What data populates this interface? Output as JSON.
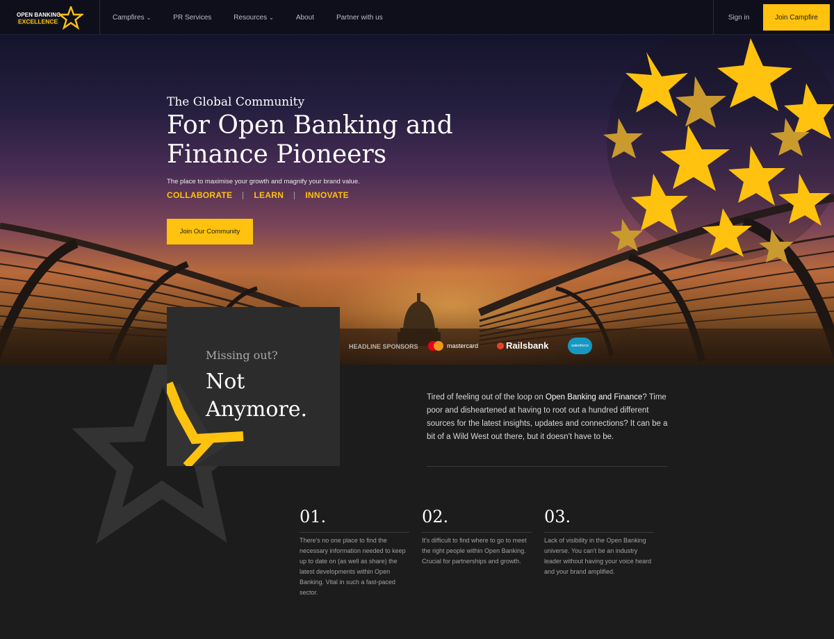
{
  "nav": {
    "logo": {
      "line1": "OPEN BANKING",
      "line2": "EXCELLENCE"
    },
    "items": [
      {
        "label": "Campfires",
        "has_dropdown": true
      },
      {
        "label": "PR Services",
        "has_dropdown": false
      },
      {
        "label": "Resources",
        "has_dropdown": true
      },
      {
        "label": "About",
        "has_dropdown": false
      },
      {
        "label": "Partner with us",
        "has_dropdown": false
      }
    ],
    "sign_in": "Sign in",
    "cta": "Join Campfire"
  },
  "hero": {
    "subtitle": "The Global Community",
    "title": "For Open Banking and Finance Pioneers",
    "description": "The place to maximise your growth and magnify your brand value.",
    "pillars": [
      "COLLABORATE",
      "LEARN",
      "INNOVATE"
    ],
    "cta": "Join Our Community"
  },
  "sponsors": {
    "label": "HEADLINE SPONSORS",
    "logos": [
      "mastercard",
      "Railsbank",
      "salesforce"
    ]
  },
  "missing": {
    "kicker": "Missing out?",
    "headline": "Not Anymore."
  },
  "intro": {
    "part1": "Tired of feeling out of the loop on ",
    "highlight": "Open Banking and Finance",
    "part2": "? Time poor and disheartened at having to root out a hundred different sources for the latest insights, updates and connections? It can be a bit of a Wild West out there, but it doesn't have to be."
  },
  "problems": [
    {
      "number": "01.",
      "text": "There's no one place to find the necessary information needed to keep up to date on (as well as share) the latest developments within Open Banking. Vital in such a fast-paced sector."
    },
    {
      "number": "02.",
      "text": "It's difficult to find where to go to meet the right people within Open Banking. Crucial for partnerships and growth."
    },
    {
      "number": "03.",
      "text": "Lack of visibility in the Open Banking universe. You can't be an industry leader without having your voice heard and your brand amplified."
    }
  ],
  "colors": {
    "accent": "#ffc20e",
    "nav_bg": "#0f0f1c",
    "page_bg": "#1c1c1c",
    "card_bg": "#2c2c2c"
  }
}
